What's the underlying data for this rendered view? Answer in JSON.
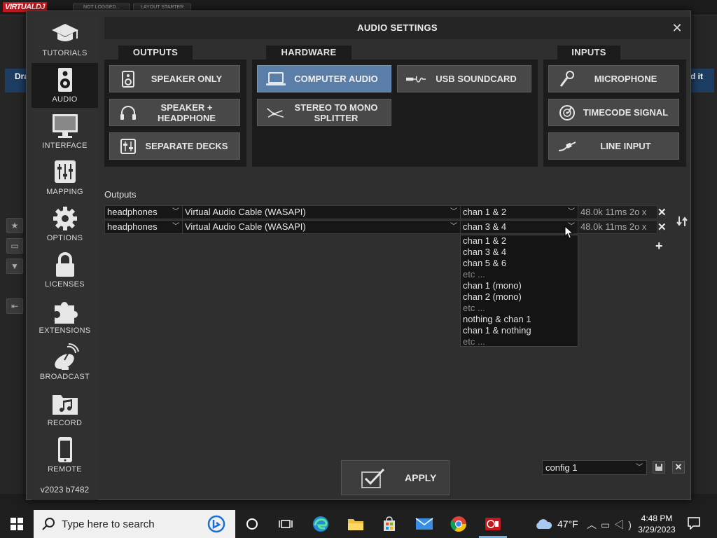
{
  "background": {
    "logo": "VIRTUALDJ",
    "logged_status": "NOT LOGGED...",
    "layout_label": "LAYOUT",
    "layout_value": "STARTER",
    "left_deck_label": "Dra",
    "right_deck_label": "d it"
  },
  "dialog": {
    "title": "AUDIO SETTINGS",
    "version": "v2023 b7482",
    "sidebar": [
      {
        "label": "TUTORIALS",
        "icon": "graduation-cap-icon"
      },
      {
        "label": "AUDIO",
        "icon": "speaker-icon"
      },
      {
        "label": "INTERFACE",
        "icon": "monitor-icon"
      },
      {
        "label": "MAPPING",
        "icon": "sliders-icon"
      },
      {
        "label": "OPTIONS",
        "icon": "gear-icon"
      },
      {
        "label": "LICENSES",
        "icon": "lock-icon"
      },
      {
        "label": "EXTENSIONS",
        "icon": "puzzle-icon"
      },
      {
        "label": "BROADCAST",
        "icon": "satellite-dish-icon"
      },
      {
        "label": "RECORD",
        "icon": "music-folder-icon"
      },
      {
        "label": "REMOTE",
        "icon": "phone-icon"
      }
    ],
    "groups": {
      "outputs": {
        "title": "OUTPUTS",
        "buttons": [
          {
            "label": "SPEAKER ONLY",
            "icon": "speaker-icon"
          },
          {
            "label": "SPEAKER +\nHEADPHONE",
            "icon": "headphones-icon"
          },
          {
            "label": "SEPARATE DECKS",
            "icon": "mixer-icon"
          }
        ]
      },
      "hardware": {
        "title": "HARDWARE",
        "buttons": [
          {
            "label": "COMPUTER AUDIO",
            "icon": "laptop-icon",
            "selected": true
          },
          {
            "label": "USB SOUNDCARD",
            "icon": "usb-icon"
          },
          {
            "label": "STEREO TO MONO\nSPLITTER",
            "icon": "splitter-cable-icon"
          }
        ]
      },
      "inputs": {
        "title": "INPUTS",
        "buttons": [
          {
            "label": "MICROPHONE",
            "icon": "microphone-icon"
          },
          {
            "label": "TIMECODE SIGNAL",
            "icon": "vinyl-icon"
          },
          {
            "label": "LINE INPUT",
            "icon": "cable-icon"
          }
        ]
      }
    },
    "outputs_label": "Outputs",
    "output_rows": [
      {
        "type": "headphones",
        "device": "Virtual Audio Cable (WASAPI)",
        "channels": "chan 1 & 2",
        "info": "48.0k 11ms 2o x"
      },
      {
        "type": "headphones",
        "device": "Virtual Audio Cable (WASAPI)",
        "channels": "chan 3 & 4",
        "info": "48.0k 11ms 2o x"
      }
    ],
    "channel_dropdown": [
      {
        "label": "chan 1 & 2",
        "dim": false
      },
      {
        "label": "chan 3 & 4",
        "dim": false
      },
      {
        "label": "chan 5 & 6",
        "dim": false
      },
      {
        "label": "etc ...",
        "dim": true
      },
      {
        "label": "chan 1 (mono)",
        "dim": false
      },
      {
        "label": "chan 2 (mono)",
        "dim": false
      },
      {
        "label": "etc ...",
        "dim": true
      },
      {
        "label": "nothing & chan 1",
        "dim": false
      },
      {
        "label": "chan 1 & nothing",
        "dim": false
      },
      {
        "label": "etc ...",
        "dim": true
      }
    ],
    "apply_label": "APPLY",
    "config_value": "config 1"
  },
  "taskbar": {
    "search_placeholder": "Type here to search",
    "weather": "47°F",
    "time": "4:48 PM",
    "date": "3/29/2023"
  },
  "colors": {
    "selected_button": "#5b7ea8",
    "panel": "#1c1c1c",
    "button": "#484848"
  }
}
